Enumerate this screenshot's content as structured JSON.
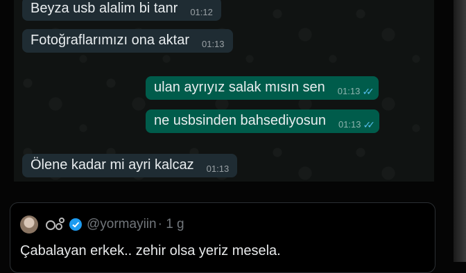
{
  "messages": [
    {
      "text": "Beyza usb alalim bi tanr",
      "time": "01:12",
      "dir": "in"
    },
    {
      "text": "Fotoğraflarımızı ona aktar",
      "time": "01:13",
      "dir": "in"
    },
    {
      "text": "ulan ayrıyız salak mısın sen",
      "time": "01:13",
      "dir": "out"
    },
    {
      "text": "ne usbsinden bahsediyosun",
      "time": "01:13",
      "dir": "out"
    },
    {
      "text": "Ölene kadar mi ayri kalcaz",
      "time": "01:13",
      "dir": "in"
    }
  ],
  "tweet": {
    "handle": "@yormayiin",
    "time": "· 1 g",
    "text": "Çabalayan erkek.. zehir olsa yeriz mesela."
  },
  "colors": {
    "incoming": "#1f2c33",
    "outgoing": "#005c4b",
    "read_ticks": "#53bdeb",
    "verified": "#1d9bf0"
  }
}
